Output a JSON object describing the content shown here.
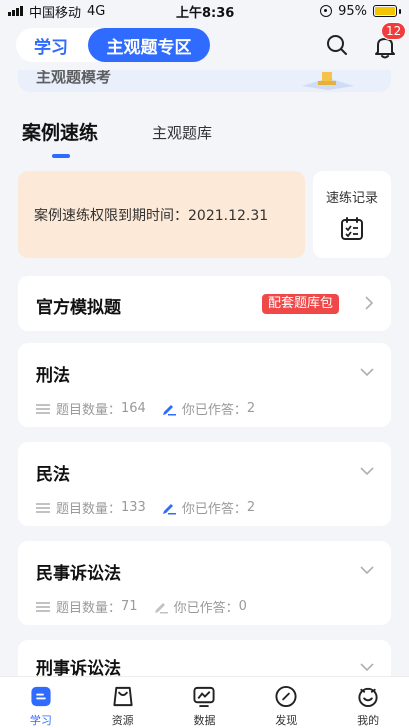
{
  "status_bar": {
    "carrier": "中国移动",
    "network": "4G",
    "time": "上午8:36",
    "battery": "95%"
  },
  "header": {
    "tab_study": "学习",
    "tab_subjective": "主观题专区",
    "notification_count": "12"
  },
  "banner": {
    "text": "主观题模考"
  },
  "subtabs": {
    "case_practice": "案例速练",
    "question_bank": "主观题库"
  },
  "expiry": {
    "text": "案例速练权限到期时间：2021.12.31"
  },
  "record": {
    "label": "速练记录"
  },
  "official": {
    "title": "官方模拟题",
    "tag": "配套题库包"
  },
  "subjects": [
    {
      "title": "刑法",
      "count_label": "题目数量：",
      "count": "164",
      "answered_label": "你已作答：",
      "answered": "2"
    },
    {
      "title": "民法",
      "count_label": "题目数量：",
      "count": "133",
      "answered_label": "你已作答：",
      "answered": "2"
    },
    {
      "title": "民事诉讼法",
      "count_label": "题目数量：",
      "count": "71",
      "answered_label": "你已作答：",
      "answered": "0"
    },
    {
      "title": "刑事诉讼法"
    }
  ],
  "tabbar": [
    {
      "label": "学习"
    },
    {
      "label": "资源"
    },
    {
      "label": "数据"
    },
    {
      "label": "发现"
    },
    {
      "label": "我的"
    }
  ],
  "colors": {
    "accent": "#2f6bff",
    "badge": "#f23c3c",
    "tag": "#f04848",
    "expiry_bg": "#fde9d7"
  }
}
